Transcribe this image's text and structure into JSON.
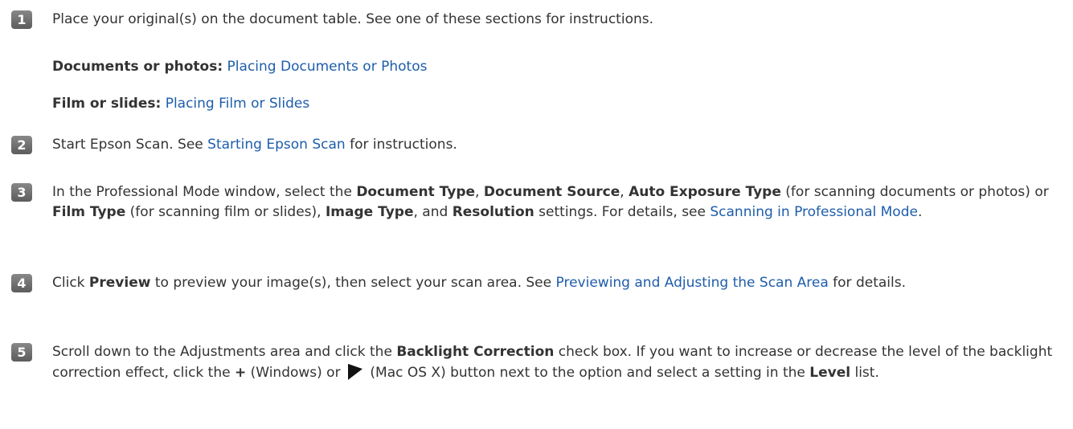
{
  "steps": [
    {
      "number": "1",
      "text_a": "Place your original(s) on the document table. See one of these sections for instructions.",
      "sub1_label": "Documents or photos:",
      "sub1_link": "Placing Documents or Photos",
      "sub2_label": "Film or slides:",
      "sub2_link": "Placing Film or Slides"
    },
    {
      "number": "2",
      "text_a": "Start Epson Scan. See ",
      "link": "Starting Epson Scan",
      "text_b": " for instructions."
    },
    {
      "number": "3",
      "t1": "In the Professional Mode window, select the ",
      "b1": "Document Type",
      "t2": ", ",
      "b2": "Document Source",
      "t3": ", ",
      "b3": "Auto Exposure Type",
      "t4": " (for scanning documents or photos) or ",
      "b4": "Film Type",
      "t5": " (for scanning film or slides), ",
      "b5": "Image Type",
      "t6": ", and ",
      "b6": "Resolution",
      "t7": " settings. For details, see ",
      "link": "Scanning in Professional Mode",
      "t8": "."
    },
    {
      "number": "4",
      "t1": "Click ",
      "b1": "Preview",
      "t2": " to preview your image(s), then select your scan area. See ",
      "link": "Previewing and Adjusting the Scan Area",
      "t3": " for details."
    },
    {
      "number": "5",
      "t1": "Scroll down to the Adjustments area and click the ",
      "b1": "Backlight Correction",
      "t2": " check box. If you want to increase or decrease the level of the backlight correction effect, click the ",
      "b2": "+",
      "t3": " (Windows) or ",
      "icon": "right-triangle-icon",
      "t4": " (Mac OS X) button next to the option and select a setting in the ",
      "b3": "Level",
      "t5": " list."
    }
  ]
}
